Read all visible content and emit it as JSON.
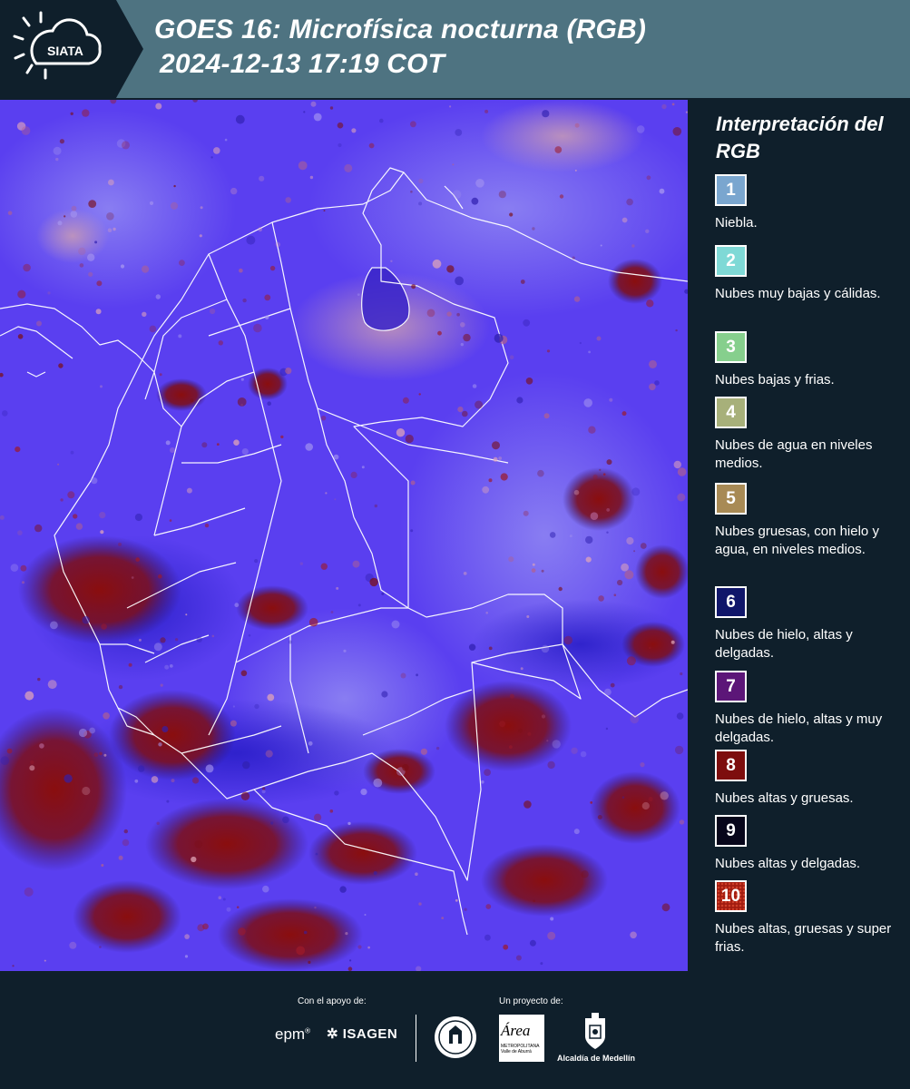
{
  "header": {
    "logo_text": "SIATA",
    "title_line1": "GOES 16: Microfísica nocturna (RGB)",
    "title_line2": "2024-12-13 17:19 COT",
    "background_color": "#4e7381"
  },
  "map": {
    "base_color": "#5a3ff0",
    "border_color": "#ffffff"
  },
  "legend": {
    "title": "Interpretación del RGB",
    "items": [
      {
        "number": "1",
        "label": "Niebla.",
        "color": "#7aa6cf"
      },
      {
        "number": "2",
        "label": "Nubes muy bajas y cálidas.",
        "color": "#7fd9d6"
      },
      {
        "number": "3",
        "label": "Nubes bajas y frias.",
        "color": "#86cf8d"
      },
      {
        "number": "4",
        "label": "Nubes de agua en niveles medios.",
        "color": "#a7b07a"
      },
      {
        "number": "5",
        "label": "Nubes gruesas, con hielo y agua, en niveles medios.",
        "color": "#a88a55"
      },
      {
        "number": "6",
        "label": "Nubes de hielo, altas y delgadas.",
        "color": "#10166a"
      },
      {
        "number": "7",
        "label": "Nubes de hielo, altas y muy delgadas.",
        "color": "#5c1678"
      },
      {
        "number": "8",
        "label": "Nubes altas y gruesas.",
        "color": "#7d0d0d"
      },
      {
        "number": "9",
        "label": "Nubes altas y delgadas.",
        "color": "#07061a"
      },
      {
        "number": "10",
        "label": "Nubes altas, gruesas y super frias.",
        "color": "#a21c10"
      }
    ]
  },
  "footer": {
    "support_label": "Con el apoyo de:",
    "project_label": "Un proyecto de:",
    "epm_logo_text": "epm",
    "isagen_logo_text": "ISAGEN",
    "area_logo_text": "Área",
    "area_logo_subtext": "METROPOLITANA Valle de Aburrá",
    "alcaldia_label": "Alcaldía de Medellín"
  }
}
